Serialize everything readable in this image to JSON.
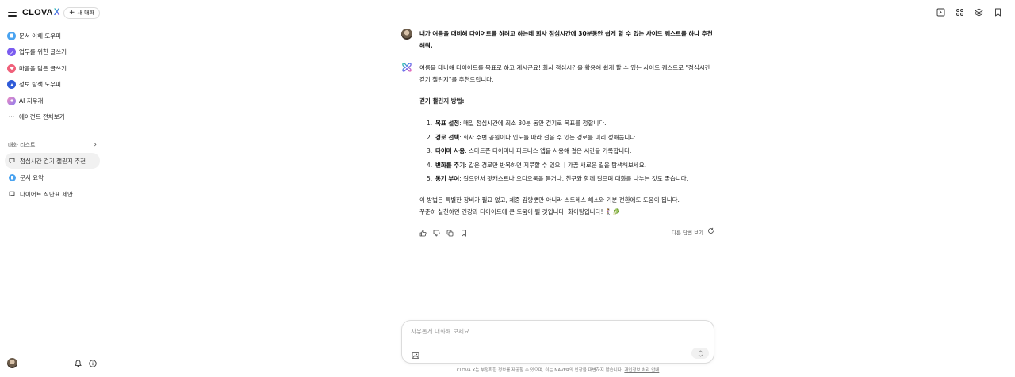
{
  "sidebar": {
    "logo_text": "CLOVA",
    "logo_x": "X",
    "new_chat_label": "새 대화",
    "agents": [
      {
        "label": "문서 이해 도우미",
        "icon": "document-agent-icon",
        "color": "#4aa3f0"
      },
      {
        "label": "업무를 위한 글쓰기",
        "icon": "writing-agent-icon",
        "color": "#7b5cf0"
      },
      {
        "label": "마음을 담은 글쓰기",
        "icon": "heart-agent-icon",
        "color": "#f0607a"
      },
      {
        "label": "정보 탐색 도우미",
        "icon": "search-agent-icon",
        "color": "#2f5bd8"
      },
      {
        "label": "AI 지우개",
        "icon": "eraser-agent-icon",
        "color": "#b57cf0"
      },
      {
        "label": "에이전트 전체보기",
        "icon": "more-dots-icon",
        "color": "#555555"
      }
    ],
    "conversation_section_label": "대화 리스트",
    "conversations": [
      {
        "label": "점심시간 걷기 챌린지 추천",
        "icon": "chat-bubble-icon",
        "active": true
      },
      {
        "label": "문서 요약",
        "icon": "document-agent-icon",
        "active": false
      },
      {
        "label": "다이어트 식단표 제안",
        "icon": "chat-bubble-icon",
        "active": false
      }
    ]
  },
  "chat": {
    "user_message": "내가 여름을 대비해 다이어트를 하려고 하는데 회사 점심시간에 30분동안 쉽게 할 수 있는 사이드 퀘스트를 하나 추천해줘.",
    "bot_intro": "여름을 대비해 다이어트를 목표로 하고 계시군요! 회사 점심시간을 활용해 쉽게 할 수 있는 사이드 퀘스트로 \"점심시간 걷기 챌린지\"를 추천드립니다.",
    "method_heading": "걷기 챌린지 방법:",
    "steps": [
      {
        "num": "1.",
        "title": "목표 설정",
        "text": ": 매일 점심시간에 최소 30분 동안 걷기로 목표를 정합니다."
      },
      {
        "num": "2.",
        "title": "경로 선택",
        "text": ": 회사 주변 공원이나 인도를 따라 걸을 수 있는 경로를 미리 정해둡니다."
      },
      {
        "num": "3.",
        "title": "타이머 사용",
        "text": ": 스마트폰 타이머나 피트니스 앱을 사용해 걸은 시간을 기록합니다."
      },
      {
        "num": "4.",
        "title": "변화를 주기",
        "text": ": 같은 경로만 반복하면 지루할 수 있으니 가끔 새로운 길을 탐색해보세요."
      },
      {
        "num": "5.",
        "title": "동기 부여",
        "text": ": 걸으면서 팟캐스트나 오디오북을 듣거나, 친구와 함께 걸으며 대화를 나누는 것도 좋습니다."
      }
    ],
    "closing_1": "이 방법은 특별한 장비가 필요 없고, 체중 감량뿐만 아니라 스트레스 해소와 기분 전환에도 도움이 됩니다.",
    "closing_2": "꾸준히 실천하면 건강과 다이어트에 큰 도움이 될 것입니다. 화이팅입니다! 🚶‍♀️🥬",
    "regenerate_label": "다른 답변 보기"
  },
  "input": {
    "placeholder": "자유롭게 대화해 보세요."
  },
  "footer": {
    "note": "CLOVA X는 부정확한 정보를 제공할 수 있으며, 이는 NAVER의 입장을 대변하지 않습니다.",
    "link": "개인정보 처리 안내"
  }
}
